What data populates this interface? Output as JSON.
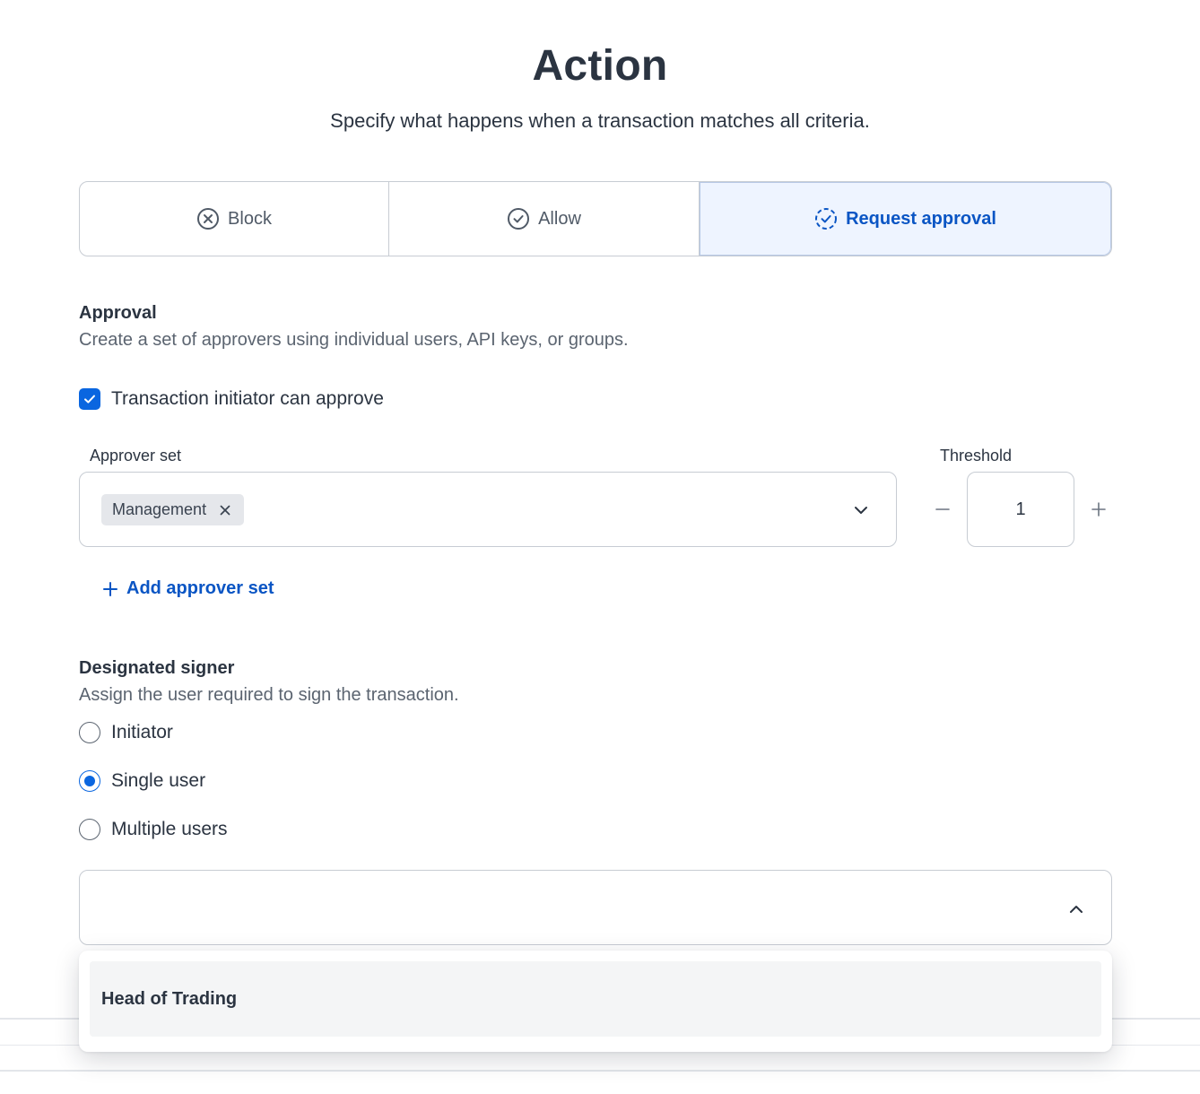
{
  "header": {
    "title": "Action",
    "subtitle": "Specify what happens when a transaction matches all criteria."
  },
  "action_options": [
    {
      "label": "Block",
      "icon": "x-circle-icon",
      "selected": false
    },
    {
      "label": "Allow",
      "icon": "check-circle-icon",
      "selected": false
    },
    {
      "label": "Request approval",
      "icon": "dashed-check-circle-icon",
      "selected": true
    }
  ],
  "approval": {
    "title": "Approval",
    "description": "Create a set of approvers using individual users, API keys, or groups.",
    "initiator_checkbox": {
      "label": "Transaction initiator can approve",
      "checked": true
    },
    "approver_set_label": "Approver set",
    "approver_set_chips": [
      "Management"
    ],
    "threshold_label": "Threshold",
    "threshold_value": "1",
    "add_approver_set": "Add approver set"
  },
  "designated_signer": {
    "title": "Designated signer",
    "description": "Assign the user required to sign the transaction.",
    "options": [
      {
        "label": "Initiator",
        "selected": false
      },
      {
        "label": "Single user",
        "selected": true
      },
      {
        "label": "Multiple users",
        "selected": false
      }
    ],
    "select_value": "",
    "dropdown_options": [
      "Head of Trading"
    ]
  },
  "colors": {
    "accent": "#0a66e0",
    "accent_text": "#0a55c4",
    "selected_bg": "#eef4ff",
    "text": "#2b3441",
    "muted": "#5b6470",
    "border": "#c7ccd3"
  }
}
